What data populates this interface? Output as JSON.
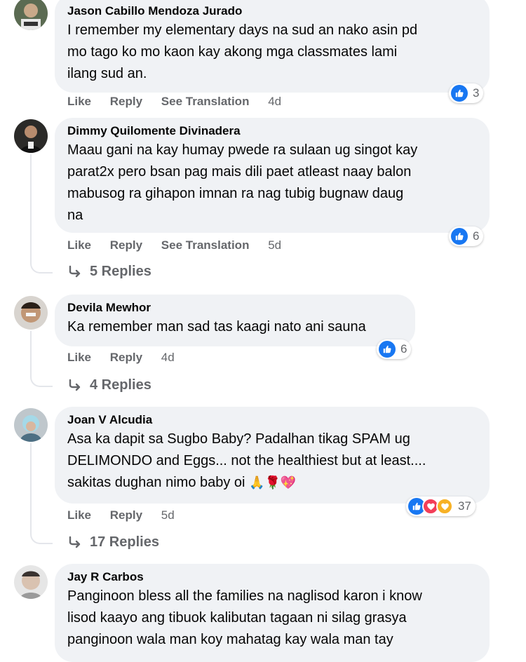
{
  "colors": {
    "bubble": "#f0f2f5",
    "meta": "#65676b",
    "like": "#1877f2",
    "love": "#f33e58",
    "care": "#f7b125"
  },
  "comments": [
    {
      "author": "Jason Cabillo Mendoza Jurado",
      "lines": [
        "I remember my elementary days na sud an nako asin pd",
        "mo tago ko mo kaon kay akong mga classmates lami",
        "ilang sud an."
      ],
      "actions": {
        "like": "Like",
        "reply": "Reply",
        "translate": "See Translation",
        "time": "4d"
      },
      "reaction_count": "3",
      "reaction_icons": [
        "like-icon"
      ]
    },
    {
      "author": "Dimmy Quilomente Divinadera",
      "lines": [
        "Maau gani na kay humay pwede ra sulaan ug singot kay",
        "parat2x pero bsan pag mais dili paet atleast naay balon",
        "mabusog ra gihapon imnan ra nag tubig bugnaw daug",
        "na"
      ],
      "actions": {
        "like": "Like",
        "reply": "Reply",
        "translate": "See Translation",
        "time": "5d"
      },
      "reaction_count": "6",
      "reaction_icons": [
        "like-icon"
      ],
      "replies": "5 Replies"
    },
    {
      "author": "Devila Mewhor",
      "lines": [
        "Ka remember man sad tas kaagi nato ani sauna"
      ],
      "actions": {
        "like": "Like",
        "reply": "Reply",
        "time": "4d"
      },
      "reaction_count": "6",
      "reaction_icons": [
        "like-icon"
      ],
      "replies": "4 Replies"
    },
    {
      "author": "Joan V Alcudia",
      "lines": [
        "Asa ka dapit sa Sugbo Baby? Padalhan tikag SPAM ug",
        "DELIMONDO and Eggs... not the healthiest but at least....",
        "sakitas dughan nimo baby oi"
      ],
      "emojis": "🙏🌹💖",
      "actions": {
        "like": "Like",
        "reply": "Reply",
        "time": "5d"
      },
      "reaction_count": "37",
      "reaction_icons": [
        "like-icon",
        "love-icon",
        "care-icon"
      ],
      "replies": "17 Replies"
    },
    {
      "author": "Jay R Carbos",
      "lines": [
        "Panginoon bless all the families na naglisod karon i know",
        "lisod kaayo ang tibuok kalibutan tagaan ni silag grasya",
        "panginoon wala man koy mahatag kay wala man tay"
      ]
    }
  ]
}
